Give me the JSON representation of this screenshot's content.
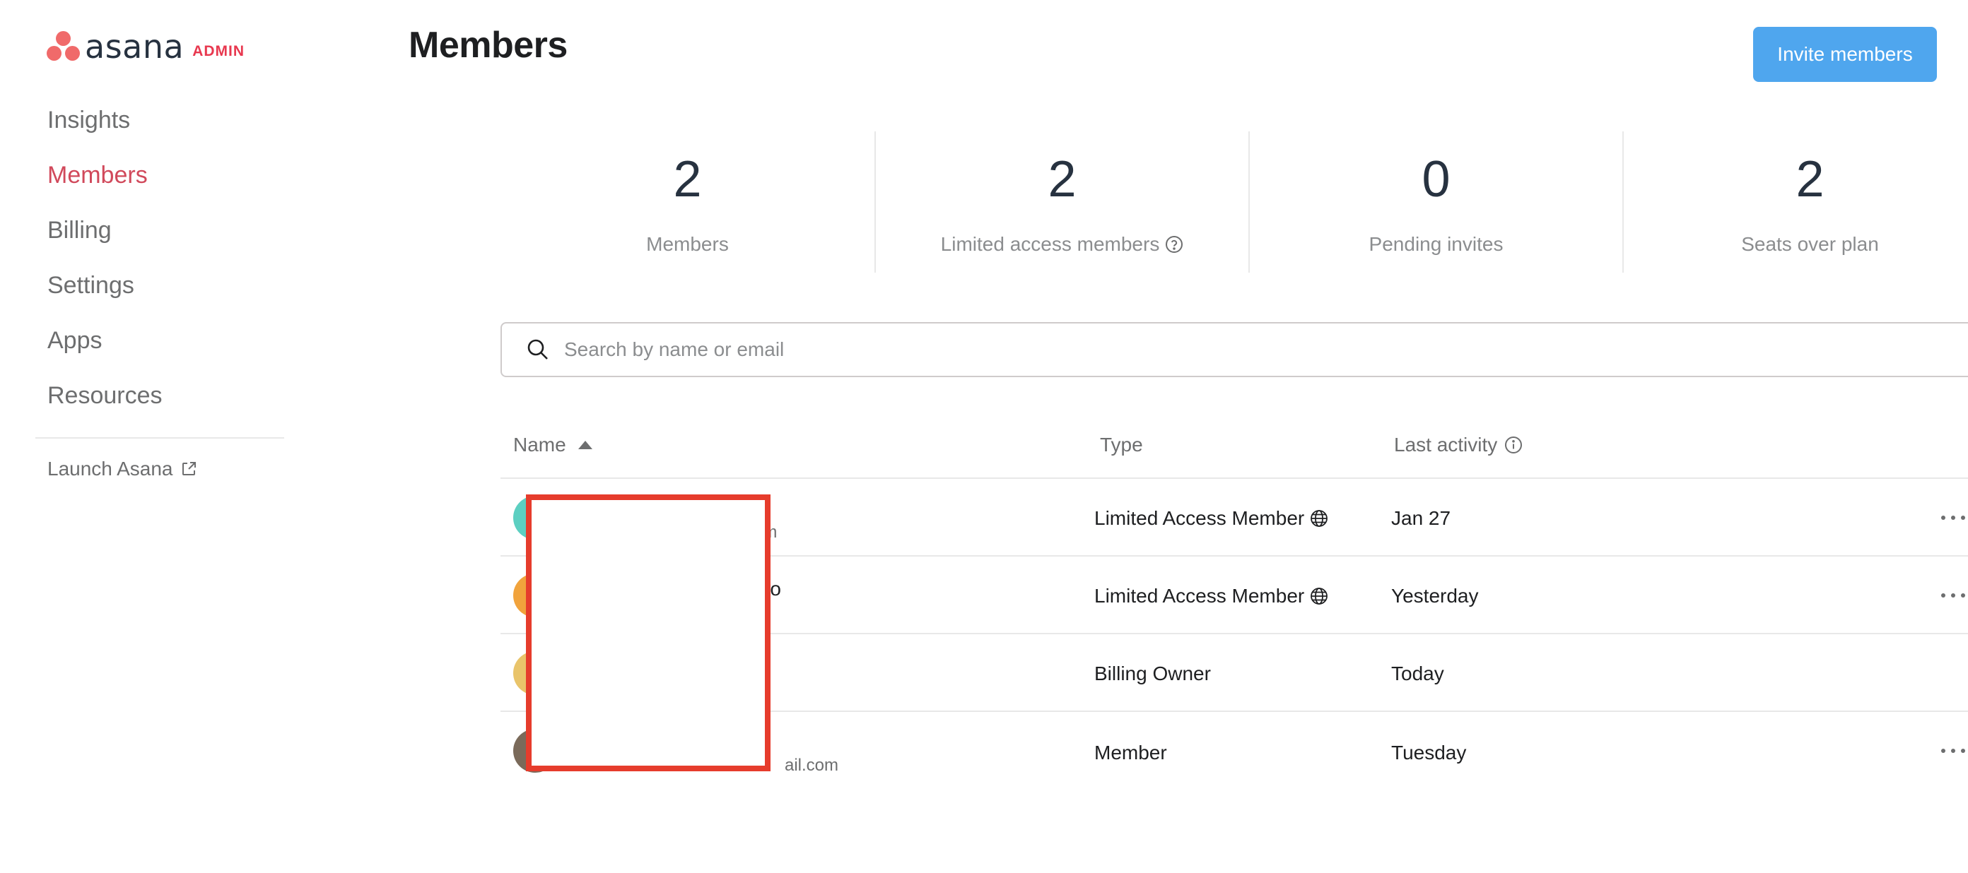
{
  "brand": {
    "word": "asana",
    "tag": "ADMIN",
    "accent": "#e8384f",
    "dot_color": "#f06a6a"
  },
  "sidebar": {
    "items": [
      {
        "label": "Insights",
        "active": false
      },
      {
        "label": "Members",
        "active": true
      },
      {
        "label": "Billing",
        "active": false
      },
      {
        "label": "Settings",
        "active": false
      },
      {
        "label": "Apps",
        "active": false
      },
      {
        "label": "Resources",
        "active": false
      }
    ],
    "launch_label": "Launch Asana",
    "launch_icon": "external-link-icon"
  },
  "header": {
    "title": "Members",
    "invite_label": "Invite members",
    "invite_color": "#4fa6ee"
  },
  "stats": [
    {
      "value": "2",
      "label": "Members"
    },
    {
      "value": "2",
      "label": "Limited access members",
      "icon": "help-circle-icon"
    },
    {
      "value": "0",
      "label": "Pending invites"
    },
    {
      "value": "2",
      "label": "Seats over plan"
    }
  ],
  "search": {
    "placeholder": "Search by name or email",
    "icon": "search-icon"
  },
  "table": {
    "columns": {
      "name": "Name",
      "type": "Type",
      "activity": "Last activity"
    },
    "rows": [
      {
        "name": "",
        "email": "om",
        "type": "Limited Access Member",
        "type_icon": "globe-icon",
        "activity": "Jan 27",
        "avatar_color": "#5ccfc1",
        "has_menu": true
      },
      {
        "name": "ro",
        "email": "",
        "type": "Limited Access Member",
        "type_icon": "globe-icon",
        "activity": "Yesterday",
        "avatar_color": "#f1a33c",
        "has_menu": true
      },
      {
        "name": "",
        "email": "",
        "type": "Billing Owner",
        "activity": "Today",
        "avatar_color": "#e9c46a",
        "has_menu": false
      },
      {
        "name": "",
        "email": "ail.com",
        "type": "Member",
        "activity": "Tuesday",
        "avatar_color": "#7a6a5a",
        "has_menu": true
      }
    ]
  }
}
